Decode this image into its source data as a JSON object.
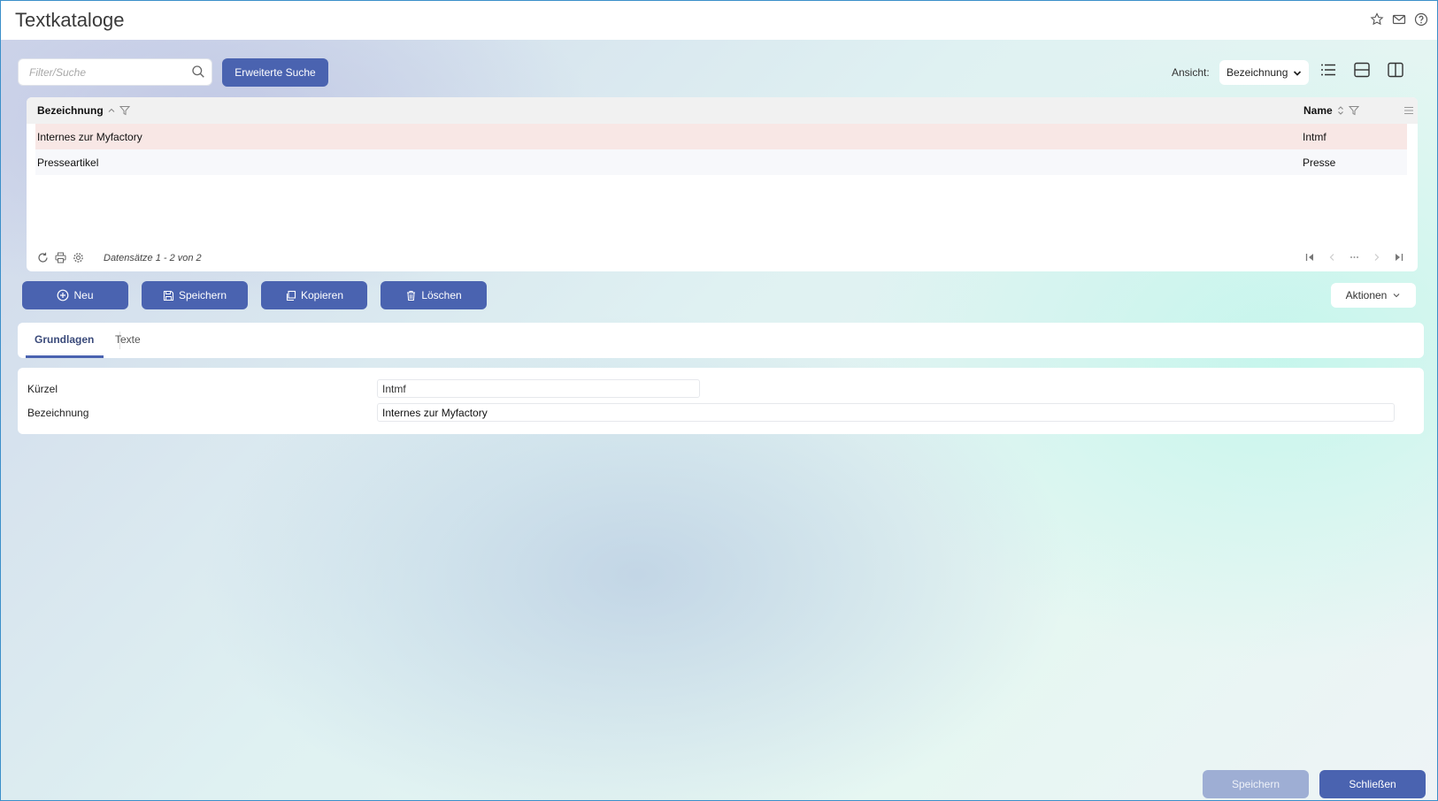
{
  "window": {
    "title": "Textkataloge"
  },
  "toolbar": {
    "search_placeholder": "Filter/Suche",
    "advanced_search_label": "Erweiterte Suche",
    "view_label": "Ansicht:",
    "view_selected": "Bezeichnung"
  },
  "grid": {
    "columns": [
      {
        "label": "Bezeichnung"
      },
      {
        "label": "Name"
      }
    ],
    "rows": [
      {
        "bezeichnung": "Internes zur Myfactory",
        "name": "Intmf",
        "selected": true
      },
      {
        "bezeichnung": "Presseartikel",
        "name": "Presse",
        "selected": false
      }
    ],
    "records_text": "Datensätze 1 - 2 von 2"
  },
  "actions": {
    "new_label": "Neu",
    "save_label": "Speichern",
    "copy_label": "Kopieren",
    "delete_label": "Löschen",
    "more_label": "Aktionen"
  },
  "tabs": [
    {
      "label": "Grundlagen",
      "active": true
    },
    {
      "label": "Texte",
      "active": false
    }
  ],
  "form": {
    "kuerzel_label": "Kürzel",
    "kuerzel_value": "Intmf",
    "bezeichnung_label": "Bezeichnung",
    "bezeichnung_value": "Internes zur Myfactory"
  },
  "footer": {
    "save_label": "Speichern",
    "close_label": "Schließen"
  },
  "colors": {
    "primary": "#4a63b0",
    "selected_row": "#f8e7e5",
    "disabled": "#9eaed4"
  }
}
